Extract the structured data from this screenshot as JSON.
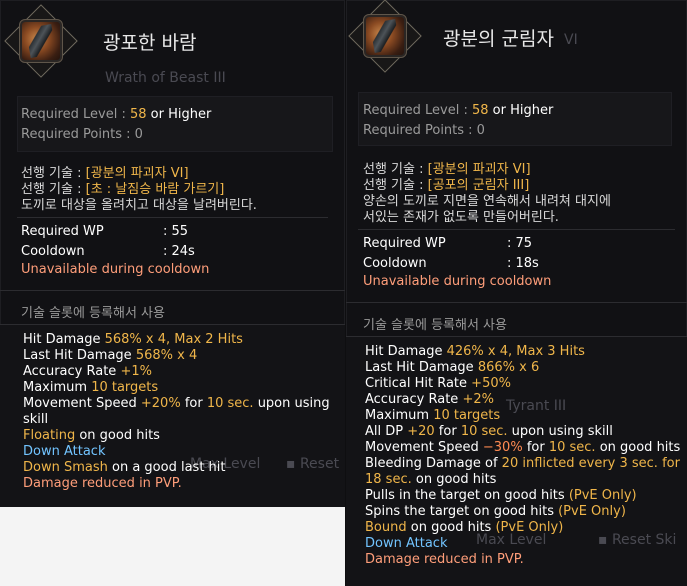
{
  "left": {
    "name": "광포한 바람",
    "ghost_title": "Wrath of Beast III",
    "required_level_label": "Required Level",
    "required_level_value": "58",
    "required_level_suffix": "or Higher",
    "required_points": "Required Points : 0",
    "prereq1_prefix": "선행 기술 : ",
    "prereq1": "[광분의 파괴자 VI]",
    "prereq2_prefix": "선행 기술 : ",
    "prereq2": "[초 : 날짐승 바람 가르기]",
    "description": "도끼로 대상을 올려치고 대상을 날려버린다.",
    "wp_label": "Required WP",
    "wp_value": ": 55",
    "cd_label": "Cooldown",
    "cd_value": ": 24s",
    "unavailable": "Unavailable during cooldown",
    "slot_text": "기술 슬롯에 등록해서 사용",
    "effects": [
      {
        "a": "Hit Damage ",
        "b": "568% x 4, Max 2 Hits"
      },
      {
        "a": "Last Hit Damage ",
        "b": "568% x 4"
      },
      {
        "a": "Accuracy Rate ",
        "b": "+1%"
      },
      {
        "a": "Maximum ",
        "b": "10 targets"
      },
      {
        "a": "Movement Speed ",
        "b": "+20%",
        "c": " for ",
        "d": "10 sec.",
        "e": " upon using"
      },
      {
        "a": "skill"
      },
      {
        "a": "Floating",
        "b": " on good hits"
      },
      {
        "a": "Down Attack"
      },
      {
        "a": "Down Smash",
        "b": " on a good last hit"
      },
      {
        "a": "Damage reduced in PVP."
      }
    ],
    "ghost_max": "Max Level",
    "ghost_reset": "Reset"
  },
  "right": {
    "name": "광분의 군림자",
    "ghost_title": "VI",
    "required_level_label": "Required Level",
    "required_level_value": "58",
    "required_level_suffix": "or Higher",
    "required_points": "Required Points : 0",
    "prereq1_prefix": "선행 기술 : ",
    "prereq1": "[광분의 파괴자 VI]",
    "prereq2_prefix": "선행 기술 : ",
    "prereq2": "[공포의 군림자 III]",
    "description1": "양손의 도끼로 지면을 연속해서 내려쳐 대지에",
    "description2": "서있는 존재가 없도록 만들어버린다.",
    "wp_label": "Required WP",
    "wp_value": ": 75",
    "cd_label": "Cooldown",
    "cd_value": ": 18s",
    "unavailable": "Unavailable during cooldown",
    "slot_text": "기술 슬롯에 등록해서 사용",
    "effects": [
      {
        "a": "Hit Damage ",
        "b": "426% x 4, Max 3 Hits"
      },
      {
        "a": "Last Hit Damage ",
        "b": "866% x 6"
      },
      {
        "a": "Critical Hit Rate ",
        "b": "+50%"
      },
      {
        "a": "Accuracy Rate ",
        "b": "+2%"
      },
      {
        "a": "Maximum ",
        "b": "10 targets"
      },
      {
        "a": "All DP ",
        "b": "+20",
        "c": " for ",
        "d": "10 sec.",
        "e": " upon using skill"
      },
      {
        "a": "Movement Speed ",
        "b": "−30%",
        "c": " for ",
        "d": "10 sec.",
        "e": " on good hits"
      },
      {
        "a": "Bleeding Damage of ",
        "b": "20 inflicted every 3 sec. for"
      },
      {
        "a": "18 sec.",
        "b": " on good hits"
      },
      {
        "a": "Pulls in the target on good hits ",
        "b": "(PvE Only)"
      },
      {
        "a": "Spins the target on good hits ",
        "b": "(PvE Only)"
      },
      {
        "a": "Bound",
        "b": " on good hits ",
        "c": "(PvE Only)"
      },
      {
        "a": "Down Attack"
      },
      {
        "a": "Damage reduced in PVP."
      }
    ],
    "ghost_tyrant": "Tyrant III",
    "ghost_max": "Max Level",
    "ghost_reset": "Reset Ski"
  }
}
